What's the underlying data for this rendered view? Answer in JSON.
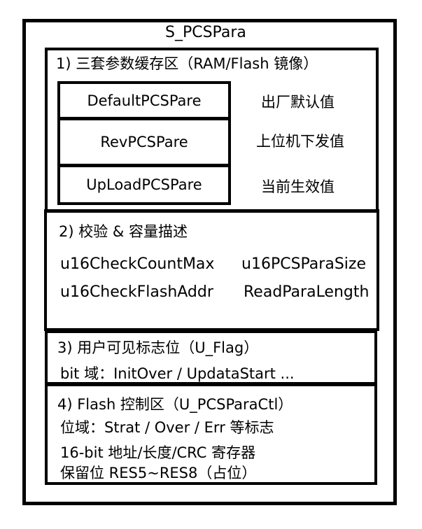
{
  "title": "S_PCSPara",
  "sections": [
    {
      "heading": "1) 三套参数缓存区（RAM/Flash 镜像）",
      "buffers": [
        {
          "name": "DefaultPCSPare",
          "desc": "出厂默认值"
        },
        {
          "name": "RevPCSPare",
          "desc": "上位机下发值"
        },
        {
          "name": "UpLoadPCSPare",
          "desc": "当前生效值"
        }
      ]
    },
    {
      "heading": "2) 校验 & 容量描述",
      "fields": [
        "u16CheckCountMax",
        "u16PCSParaSize",
        "u16CheckFlashAddr",
        "ReadParaLength"
      ]
    },
    {
      "heading": "3) 用户可见标志位（U_Flag）",
      "lines": [
        "bit 域：InitOver / UpdataStart ..."
      ]
    },
    {
      "heading": "4) Flash 控制区（U_PCSParaCtl）",
      "lines": [
        "位域：Strat / Over / Err 等标志",
        "16-bit 地址/长度/CRC 寄存器",
        "保留位 RES5~RES8（占位）"
      ]
    }
  ]
}
